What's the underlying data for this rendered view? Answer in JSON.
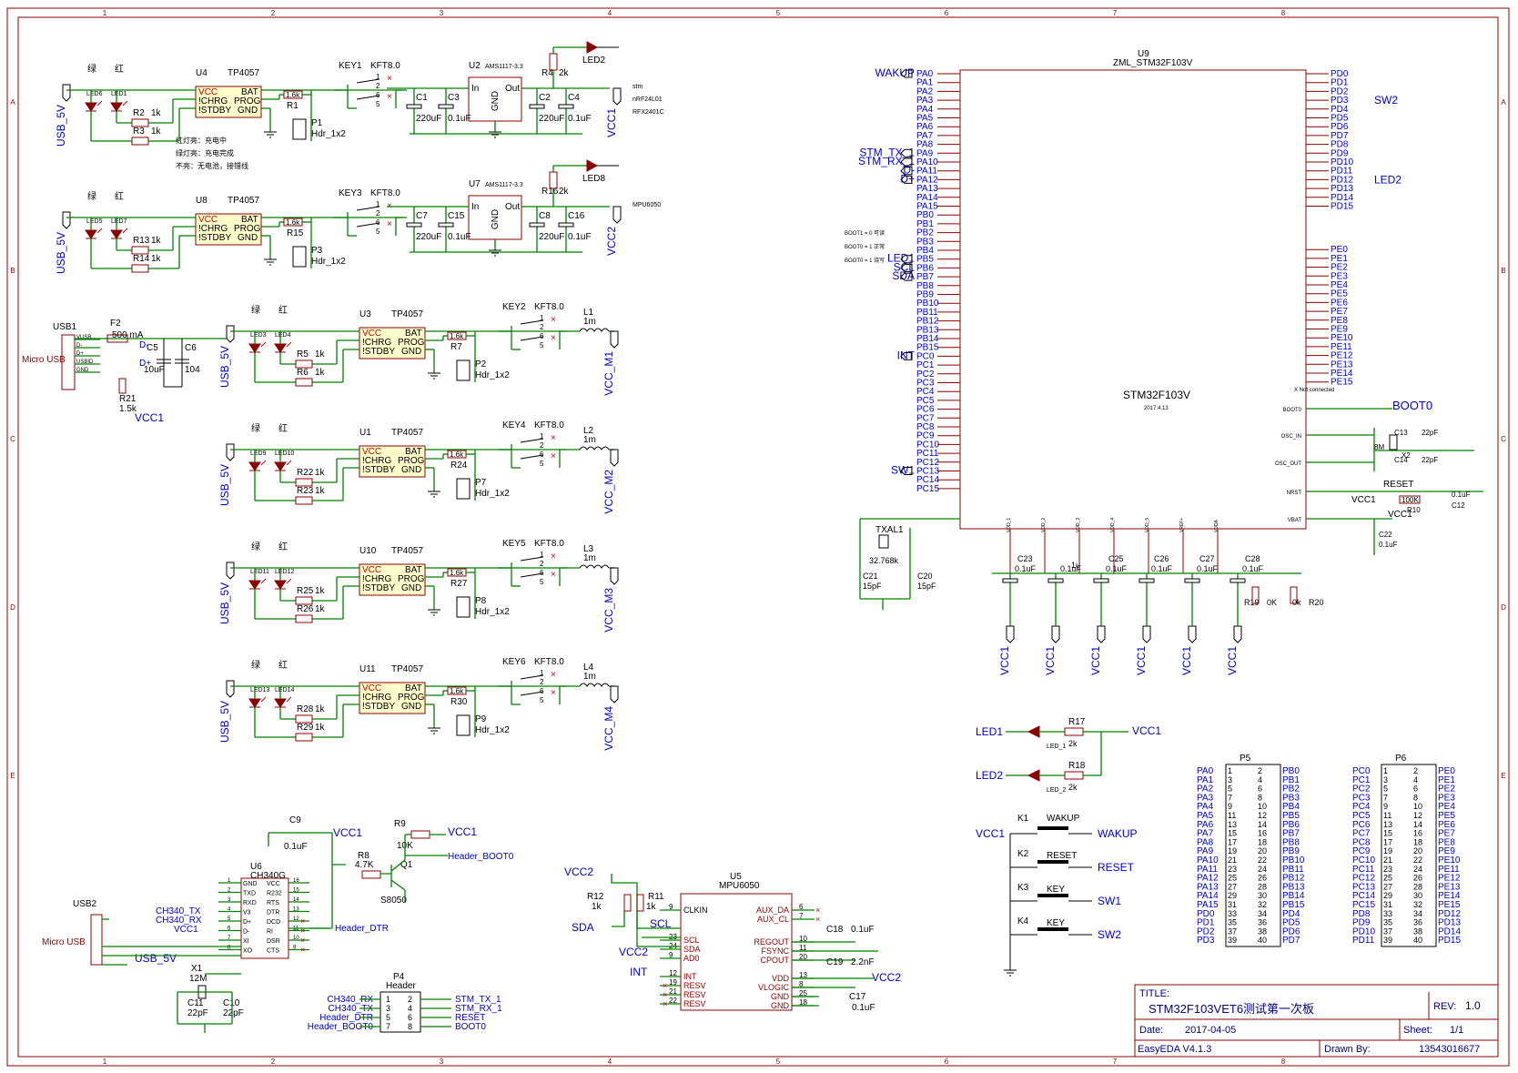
{
  "sheet": {
    "zone_cols": [
      "1",
      "2",
      "3",
      "4",
      "5",
      "6",
      "7",
      "8"
    ],
    "zone_rows": [
      "A",
      "B",
      "C",
      "D",
      "E"
    ]
  },
  "title_block": {
    "title_label": "TITLE:",
    "title": "STM32F103VET6测试第一次板",
    "rev_label": "REV:",
    "rev": "1.0",
    "date_label": "Date:",
    "date": "2017-04-05",
    "sheet_label": "Sheet:",
    "sheet": "1/1",
    "tool": "EasyEDA V4.1.3",
    "drawn_label": "Drawn By:",
    "drawn": "13543016677"
  },
  "chargers": [
    {
      "ref": "U4",
      "part": "TP4057",
      "led_g": "LED6",
      "led_r": "LED1",
      "r_a": "R2",
      "r_b": "R3",
      "r_prog": "R1",
      "r_val": "1.6k",
      "key": "KEY1",
      "hdr": "P1",
      "hdr_type": "Hdr_1x2",
      "usb": "USB_5V",
      "green": "绿",
      "red": "红"
    },
    {
      "ref": "U8",
      "part": "TP4057",
      "led_g": "LED5",
      "led_r": "LED7",
      "r_a": "R13",
      "r_b": "R14",
      "r_prog": "R15",
      "r_val": "1.6k",
      "key": "KEY3",
      "hdr": "P3",
      "hdr_type": "Hdr_1x2",
      "usb": "USB_5V",
      "green": "绿",
      "red": "红"
    },
    {
      "ref": "U3",
      "part": "TP4057",
      "led_g": "LED3",
      "led_r": "LED4",
      "r_a": "R5",
      "r_b": "R6",
      "r_prog": "R7",
      "r_val": "1.6k",
      "key": "KEY2",
      "hdr": "P2",
      "hdr_type": "Hdr_1x2",
      "usb": "USB_5V",
      "green": "绿",
      "red": "红",
      "l": "L1",
      "lv": "1m",
      "out": "VCC_M1"
    },
    {
      "ref": "U1",
      "part": "TP4057",
      "led_g": "LED9",
      "led_r": "LED10",
      "r_a": "R22",
      "r_b": "R23",
      "r_prog": "R24",
      "r_val": "1.6k",
      "key": "KEY4",
      "hdr": "P7",
      "hdr_type": "Hdr_1x2",
      "usb": "USB_5V",
      "green": "绿",
      "red": "红",
      "l": "L2",
      "lv": "1m",
      "out": "VCC_M2"
    },
    {
      "ref": "U10",
      "part": "TP4057",
      "led_g": "LED11",
      "led_r": "LED12",
      "r_a": "R25",
      "r_b": "R26",
      "r_prog": "R27",
      "r_val": "1.6k",
      "key": "KEY5",
      "hdr": "P8",
      "hdr_type": "Hdr_1x2",
      "usb": "USB_5V",
      "green": "绿",
      "red": "红",
      "l": "L3",
      "lv": "1m",
      "out": "VCC_M3"
    },
    {
      "ref": "U11",
      "part": "TP4057",
      "led_g": "LED13",
      "led_r": "LED14",
      "r_a": "R28",
      "r_b": "R29",
      "r_prog": "R30",
      "r_val": "1.6k",
      "key": "KEY6",
      "hdr": "P9",
      "hdr_type": "Hdr_1x2",
      "usb": "USB_5V",
      "green": "绿",
      "red": "红",
      "l": "L4",
      "lv": "1m",
      "out": "VCC_M4"
    }
  ],
  "tp_pins": {
    "vcc": "VCC",
    "chrg": "!CHRG",
    "stdby": "!STDBY",
    "bat": "BAT",
    "prog": "PROG",
    "gnd": "GND",
    "r1k": "1k",
    "kft": "KFT8.0"
  },
  "status_notes": [
    "红灯亮：充电中",
    "绿灯亮：充电完成",
    "不亮：无电池，接错线"
  ],
  "regs": [
    {
      "ref": "U2",
      "part": "AMS1117-3.3",
      "in": "In",
      "gnd": "GND",
      "out": "Out",
      "c_in": "C1",
      "c_in_v": "220uF",
      "c_in2": "C3",
      "c_in2_v": "0.1uF",
      "c_out": "C2",
      "c_out_v": "220uF",
      "c_out2": "C4",
      "c_out2_v": "0.1uF",
      "r": "R4",
      "rv": "2k",
      "led": "LED2",
      "net": "VCC1",
      "notes": [
        "stm",
        "nRF24L01",
        "RFX2401C"
      ]
    },
    {
      "ref": "U7",
      "part": "AMS1117-3.3",
      "in": "In",
      "gnd": "GND",
      "out": "Out",
      "c_in": "C7",
      "c_in_v": "220uF",
      "c_in2": "C15",
      "c_in2_v": "0.1uF",
      "c_out": "C8",
      "c_out_v": "220uF",
      "c_out2": "C16",
      "c_out2_v": "0.1uF",
      "r": "R16",
      "rv": "2k",
      "led": "LED8",
      "net": "VCC2",
      "notes": [
        "MPU6050"
      ]
    }
  ],
  "usb1": {
    "ref": "USB1",
    "type": "Micro USB",
    "pins": [
      "VUSB",
      "D-",
      "D+",
      "USBID",
      "GND"
    ],
    "f": "F2",
    "fv": "500 mA",
    "c5": "C5",
    "c5v": "10uF",
    "c6": "C6",
    "c6v": "104",
    "dm": "D-",
    "dp": "D+",
    "r21": "R21",
    "r21v": "1.5k",
    "vcc": "VCC1"
  },
  "mcu": {
    "ref": "U9",
    "lib": "ZML_STM32F103V",
    "name": "STM32F103V",
    "date": "2017.4.13",
    "left_pins": [
      "PA0",
      "PA1",
      "PA2",
      "PA3",
      "PA4",
      "PA5",
      "PA6",
      "PA7",
      "PA8",
      "PA9",
      "PA10",
      "PA11",
      "PA12",
      "PA13",
      "PA14",
      "PA15",
      "PB0",
      "PB1",
      "PB2",
      "PB3",
      "PB4",
      "PB5",
      "PB6",
      "PB7",
      "PB8",
      "PB9",
      "PB10",
      "PB11",
      "PB12",
      "PB13",
      "PB14",
      "PB15",
      "PC0",
      "PC1",
      "PC2",
      "PC3",
      "PC4",
      "PC5",
      "PC6",
      "PC7",
      "PC8",
      "PC9",
      "PC10",
      "PC11",
      "PC12",
      "PC13",
      "PC14",
      "PC15"
    ],
    "right_pins": [
      "PD0",
      "PD1",
      "PD2",
      "PD3",
      "PD4",
      "PD5",
      "PD6",
      "PD7",
      "PD8",
      "PD9",
      "PD10",
      "PD11",
      "PD12",
      "PD13",
      "PD14",
      "PD15",
      "PE0",
      "PE1",
      "PE2",
      "PE3",
      "PE4",
      "PE5",
      "PE6",
      "PE7",
      "PE8",
      "PE9",
      "PE10",
      "PE11",
      "PE12",
      "PE13",
      "PE14",
      "PE15"
    ],
    "left_nets": {
      "PA0": "WAKUP",
      "PA9": "STM_TX_1",
      "PA10": "STM_RX_1",
      "PA11": "D-",
      "PA12": "D+",
      "PB5": "LED1",
      "PB6": "SCL",
      "PB7": "SDA",
      "PC0": "INT",
      "PC13": "SW1"
    },
    "right_nets": {
      "PD3": "SW2",
      "PD12": "LED2"
    },
    "boot_notes": [
      "BOOT1 = 0 可读",
      "BOOT0 = 1 正常",
      "BOOT0 = 1 烧写"
    ],
    "special": [
      "BOOT0",
      "OSC_IN",
      "OSC_OUT",
      "NRST",
      "VBAT"
    ],
    "not_connected": "X Not connected",
    "vdd": [
      "VDD_1",
      "VDD_2",
      "VDD_3",
      "VDD_4",
      "VDD_5",
      "VREF+",
      "VDDA"
    ],
    "boot0": "BOOT0",
    "reset": "RESET",
    "vcc": "VCC1",
    "r10": "R10",
    "r10v": "100K",
    "c12": "C12",
    "c12v": "0.1uF",
    "x2": "X2",
    "x2v": "8M",
    "c13": "C13",
    "c13v": "22pF",
    "c14": "C14",
    "c14v": "22pF",
    "c22": "C22",
    "c22v": "0.1uF",
    "txal": "TXAL1",
    "txalv": "32.768k",
    "c21": "C21",
    "c21v": "15pF",
    "c20": "C20",
    "c20v": "15pF",
    "decaps": [
      [
        "C23",
        "0.1uF"
      ],
      [
        "",
        "0.1uF"
      ],
      [
        "C25",
        "0.1uF"
      ],
      [
        "C26",
        "0.1uF"
      ],
      [
        "C27",
        "0.1uF"
      ],
      [
        "C28",
        "0.1uF"
      ]
    ],
    "r19": "R19",
    "r19v": "0K",
    "r20": "R20",
    "r20v": "0k",
    "c_1u": "1u"
  },
  "leds": [
    {
      "net": "LED1",
      "led": "LED_1",
      "r": "R17",
      "rv": "2k",
      "vcc": "VCC1"
    },
    {
      "net": "LED2",
      "led": "LED_2",
      "r": "R18",
      "rv": "2k"
    }
  ],
  "keys": [
    {
      "ref": "K1",
      "label": "WAKUP",
      "net": "WAKUP",
      "left": "VCC1"
    },
    {
      "ref": "K2",
      "label": "RESET",
      "net": "RESET"
    },
    {
      "ref": "K3",
      "label": "KEY",
      "net": "SW1"
    },
    {
      "ref": "K4",
      "label": "KEY",
      "net": "SW2"
    }
  ],
  "p5": {
    "ref": "P5",
    "left": [
      "PA0",
      "PA1",
      "PA2",
      "PA3",
      "PA4",
      "PA5",
      "PA6",
      "PA7",
      "PA8",
      "PA9",
      "PA10",
      "PA11",
      "PA12",
      "PA13",
      "PA14",
      "PA15",
      "PD0",
      "PD1",
      "PD2",
      "PD3"
    ],
    "right": [
      "PB0",
      "PB1",
      "PB2",
      "PB3",
      "PB4",
      "PB5",
      "PB6",
      "PB7",
      "PB8",
      "PB9",
      "PB10",
      "PB11",
      "PB12",
      "PB13",
      "PB14",
      "PB15",
      "PD4",
      "PD5",
      "PD6",
      "PD7"
    ]
  },
  "p6": {
    "ref": "P6",
    "left": [
      "PC0",
      "PC1",
      "PC2",
      "PC3",
      "PC4",
      "PC5",
      "PC6",
      "PC7",
      "PC8",
      "PC9",
      "PC10",
      "PC11",
      "PC12",
      "PC13",
      "PC14",
      "PC15",
      "PD8",
      "PD9",
      "PD10",
      "PD11"
    ],
    "right": [
      "PE0",
      "PE1",
      "PE2",
      "PE3",
      "PE4",
      "PE5",
      "PE6",
      "PE7",
      "PE8",
      "PE9",
      "PE10",
      "PE11",
      "PE12",
      "PE13",
      "PE14",
      "PE15",
      "PD12",
      "PD13",
      "PD14",
      "PD15"
    ]
  },
  "ch340": {
    "ref": "U6",
    "part": "CH340G",
    "left": [
      "GND",
      "TXD",
      "RXD",
      "V3",
      "D+",
      "D-",
      "XI",
      "XO"
    ],
    "right": [
      "VCC",
      "R232",
      "RTS",
      "DTR",
      "DCD",
      "RI",
      "DSR",
      "CTS"
    ],
    "c9": "C9",
    "c9v": "0.1uF",
    "vcc": "VCC1",
    "r8": "R8",
    "r8v": "4.7K",
    "r9": "R9",
    "r9v": "10K",
    "q1": "Q1",
    "q1v": "S8050",
    "nets": [
      "CH340_TX",
      "CH340_RX",
      "VCC1",
      "Header_DTR",
      "Header_BOOT0",
      "USB_5V"
    ],
    "x1": "X1",
    "x1v": "12M",
    "c11": "C11",
    "c11v": "22pF",
    "c10": "C10",
    "c10v": "22pF",
    "usb": "USB2",
    "usb_type": "Micro USB"
  },
  "p4": {
    "ref": "P4",
    "type": "Header",
    "left": [
      "CH340_RX",
      "CH340_TX",
      "Header_DTR",
      "Header_BOOT0"
    ],
    "right": [
      "STM_TX_1",
      "STM_RX_1",
      "RESET",
      "BOOT0"
    ]
  },
  "mpu": {
    "ref": "U5",
    "part": "MPU6050",
    "left": [
      "CLKIN",
      "SCL",
      "SDA",
      "AD0",
      "INT",
      "RESV",
      "RESV",
      "RESV"
    ],
    "right": [
      "AUX_DA",
      "AUX_CL",
      "REGOUT",
      "FSYNC",
      "CPOUT",
      "VDD",
      "VLOGIC",
      "GND",
      "GND"
    ],
    "r12": "R12",
    "r12v": "1k",
    "r11": "R11",
    "r11v": "1k",
    "vcc": "VCC2",
    "c18": "C18",
    "c18v": "0.1uF",
    "c19": "C19",
    "c19v": "2.2nF",
    "c17": "C17",
    "c17v": "0.1uF"
  }
}
